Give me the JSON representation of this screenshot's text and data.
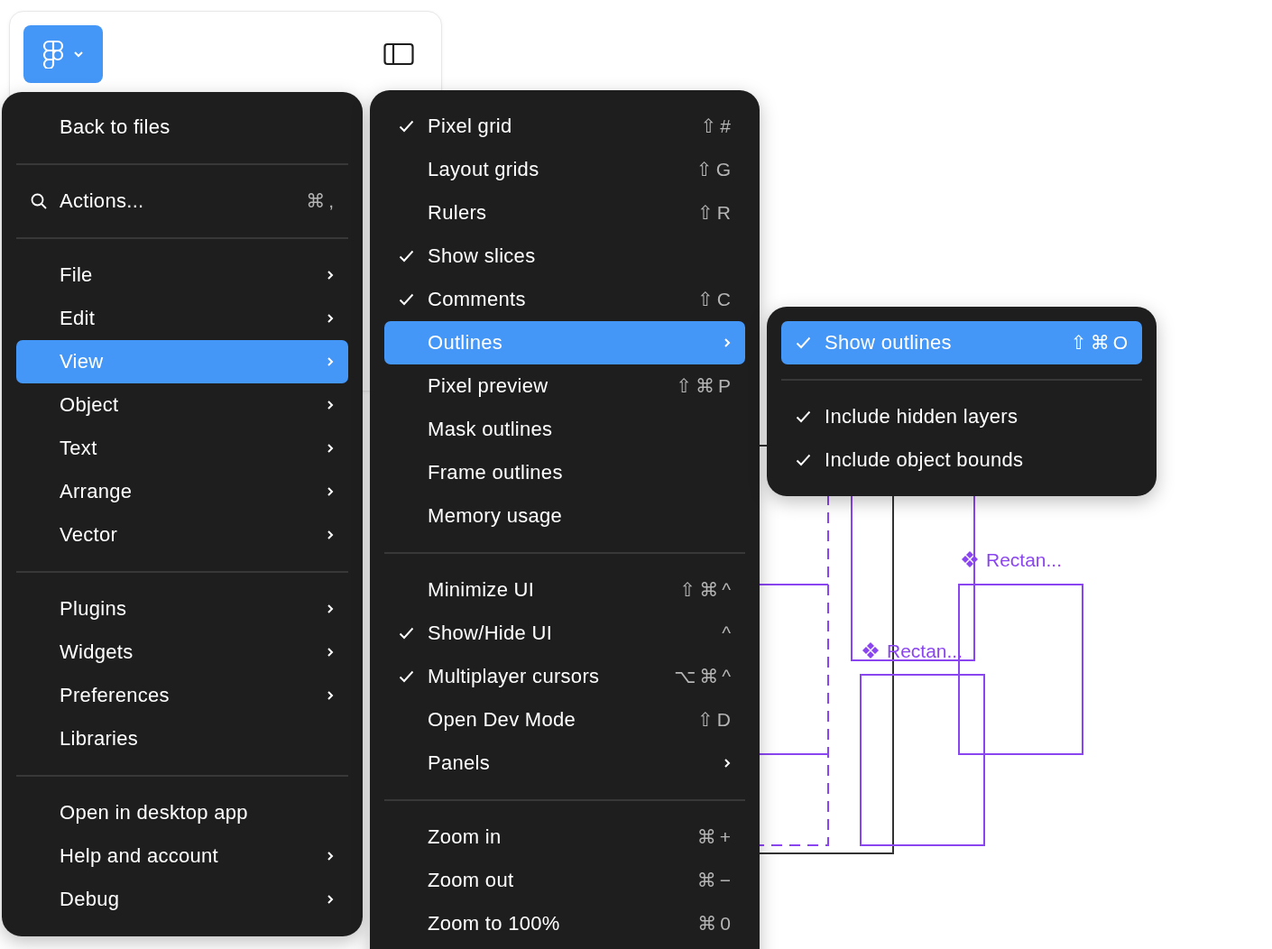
{
  "main_menu": {
    "sections": [
      {
        "items": [
          {
            "label": "Back to files",
            "selected": false
          }
        ]
      },
      {
        "items": [
          {
            "label": "Actions...",
            "kind": "search",
            "shortcut": "⌘,",
            "selected": false
          }
        ]
      },
      {
        "items": [
          {
            "label": "File",
            "submenu": true,
            "selected": false
          },
          {
            "label": "Edit",
            "submenu": true,
            "selected": false
          },
          {
            "label": "View",
            "submenu": true,
            "selected": true
          },
          {
            "label": "Object",
            "submenu": true,
            "selected": false
          },
          {
            "label": "Text",
            "submenu": true,
            "selected": false
          },
          {
            "label": "Arrange",
            "submenu": true,
            "selected": false
          },
          {
            "label": "Vector",
            "submenu": true,
            "selected": false
          }
        ]
      },
      {
        "items": [
          {
            "label": "Plugins",
            "submenu": true,
            "selected": false
          },
          {
            "label": "Widgets",
            "submenu": true,
            "selected": false
          },
          {
            "label": "Preferences",
            "submenu": true,
            "selected": false
          },
          {
            "label": "Libraries",
            "selected": false
          }
        ]
      },
      {
        "items": [
          {
            "label": "Open in desktop app",
            "selected": false
          },
          {
            "label": "Help and account",
            "submenu": true,
            "selected": false
          },
          {
            "label": "Debug",
            "submenu": true,
            "selected": false
          }
        ]
      }
    ]
  },
  "view_menu": {
    "sections": [
      {
        "items": [
          {
            "label": "Pixel grid",
            "shortcut": "⇧#",
            "checked": true,
            "selected": false
          },
          {
            "label": "Layout grids",
            "shortcut": "⇧G",
            "checked": false,
            "selected": false
          },
          {
            "label": "Rulers",
            "shortcut": "⇧R",
            "checked": false,
            "selected": false
          },
          {
            "label": "Show slices",
            "checked": true,
            "selected": false
          },
          {
            "label": "Comments",
            "shortcut": "⇧C",
            "checked": true,
            "selected": false
          },
          {
            "label": "Outlines",
            "submenu": true,
            "checked": false,
            "selected": true
          },
          {
            "label": "Pixel preview",
            "shortcut": "⇧⌘P",
            "checked": false,
            "selected": false
          },
          {
            "label": "Mask outlines",
            "checked": false,
            "selected": false
          },
          {
            "label": "Frame outlines",
            "checked": false,
            "selected": false
          },
          {
            "label": "Memory usage",
            "checked": false,
            "selected": false
          }
        ]
      },
      {
        "items": [
          {
            "label": "Minimize UI",
            "shortcut": "⇧⌘^",
            "checked": false,
            "selected": false
          },
          {
            "label": "Show/Hide UI",
            "shortcut": "^",
            "checked": true,
            "selected": false
          },
          {
            "label": "Multiplayer cursors",
            "shortcut": "⌥⌘^",
            "checked": true,
            "selected": false
          },
          {
            "label": "Open Dev Mode",
            "shortcut": "⇧D",
            "checked": false,
            "selected": false
          },
          {
            "label": "Panels",
            "submenu": true,
            "checked": false,
            "selected": false
          }
        ]
      },
      {
        "items": [
          {
            "label": "Zoom in",
            "shortcut": "⌘+",
            "checked": false,
            "selected": false
          },
          {
            "label": "Zoom out",
            "shortcut": "⌘−",
            "checked": false,
            "selected": false
          },
          {
            "label": "Zoom to 100%",
            "shortcut": "⌘0",
            "checked": false,
            "selected": false
          }
        ]
      }
    ]
  },
  "outlines_menu": {
    "sections": [
      {
        "items": [
          {
            "label": "Show outlines",
            "shortcut": "⇧⌘O",
            "checked": true,
            "selected": true
          }
        ]
      },
      {
        "items": [
          {
            "label": "Include hidden layers",
            "checked": true,
            "selected": false
          },
          {
            "label": "Include object bounds",
            "checked": true,
            "selected": false
          }
        ]
      }
    ]
  },
  "canvas": {
    "layer_labels": [
      {
        "label": "Rectan..."
      },
      {
        "label": "Rectan..."
      }
    ]
  }
}
